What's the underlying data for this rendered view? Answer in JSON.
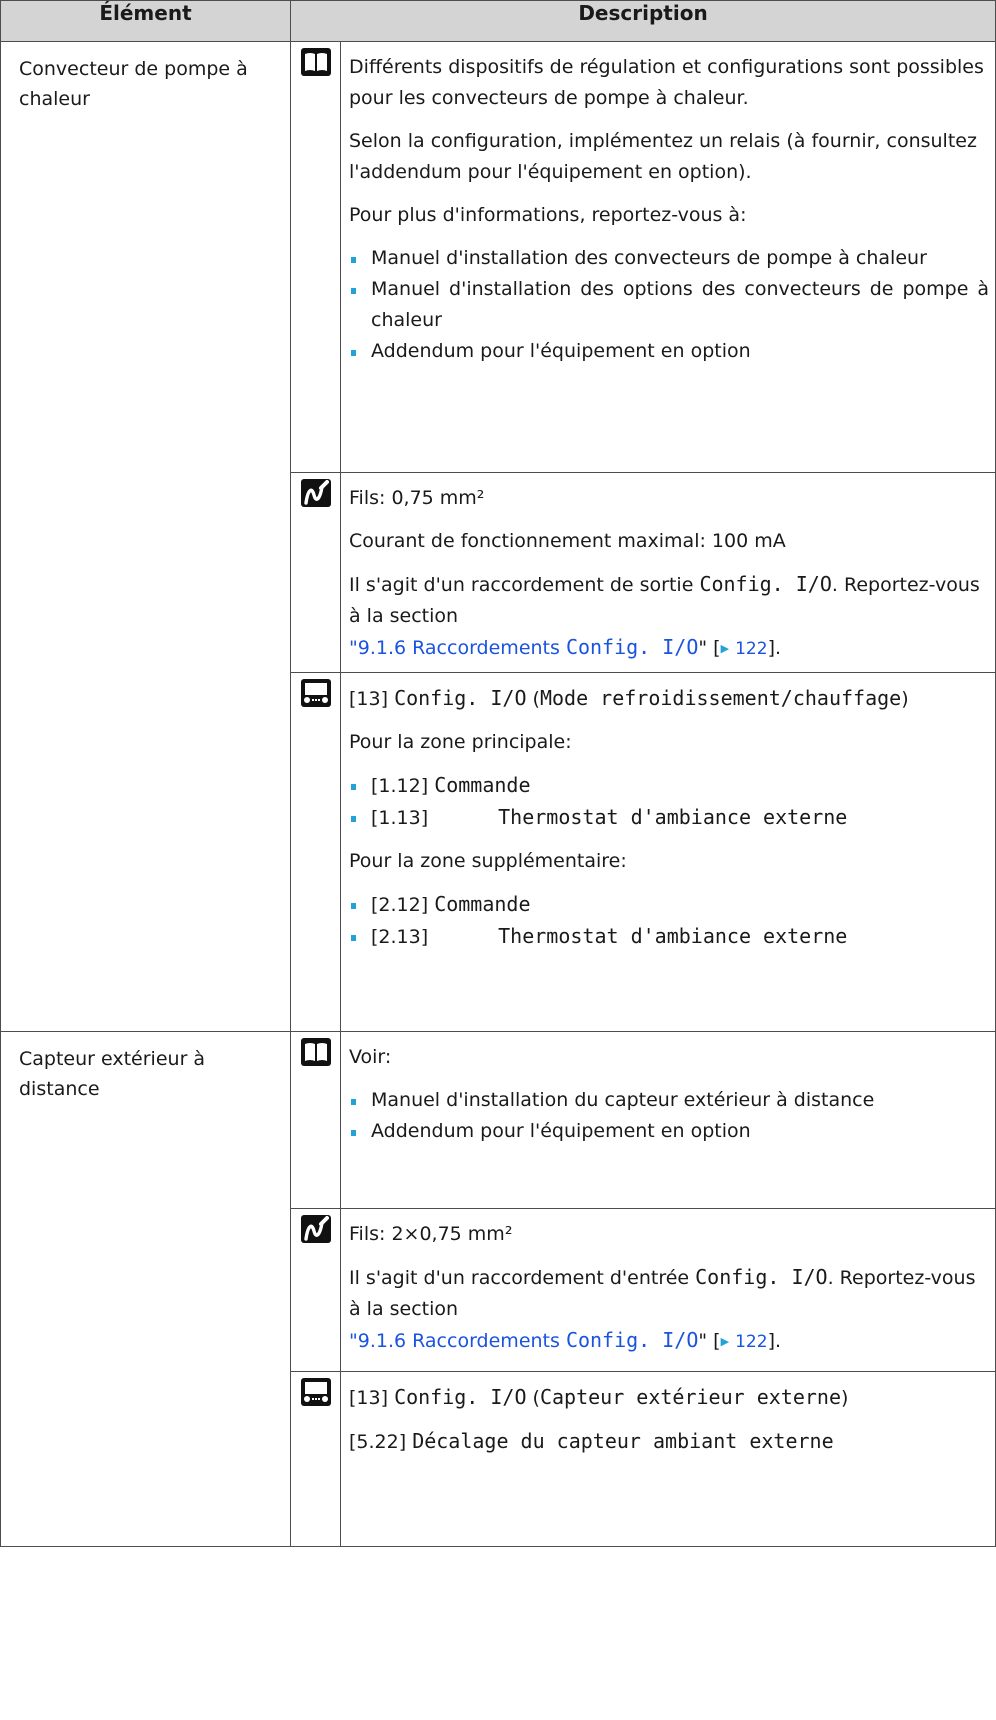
{
  "header": {
    "col_element": "Élément",
    "col_description": "Description"
  },
  "rows": [
    {
      "item": "Convecteur de pompe à chaleur",
      "book": {
        "p1": "Différents dispositifs de régulation et configurations sont possibles pour les convecteurs de pompe à chaleur.",
        "p2": "Selon la configuration, implémentez un relais (à fournir, consultez l'addendum pour l'équipement en option).",
        "p3": "Pour plus d'informations, reportez-vous à:",
        "bullets": [
          "Manuel d'installation des convecteurs de pompe à chaleur",
          "Manuel d'installation des options des convecteurs de pompe à chaleur",
          "Addendum pour l'équipement en option"
        ]
      },
      "wiring": {
        "p1": "Fils: 0,75 mm²",
        "p2": "Courant de fonctionnement maximal: 100 mA",
        "p3_before": "Il s'agit d'un raccordement de sortie ",
        "p3_mono": "Config. I/O",
        "p3_after": ". Reportez-vous à la section",
        "link_quote_open": "\"",
        "link_text": "9.1.6 Raccordements ",
        "link_mono": "Config. I/O",
        "link_quote_close": "\"",
        "ref_open": " [",
        "ref_page": "122",
        "ref_close": "]."
      },
      "ui": {
        "code": "[13]",
        "mono": "Config. I/O",
        "mode_open": " (",
        "mode_mono": "Mode refroidissement/chauffage",
        "mode_close": ")",
        "main_zone_label": "Pour la zone principale:",
        "main_bullets": [
          {
            "code": "[1.12]",
            "mono": "Commande"
          },
          {
            "code": "[1.13]",
            "mono": "Thermostat d'ambiance externe"
          }
        ],
        "add_zone_label": "Pour la zone supplémentaire:",
        "add_bullets": [
          {
            "code": "[2.12]",
            "mono": "Commande"
          },
          {
            "code": "[2.13]",
            "mono": "Thermostat d'ambiance externe"
          }
        ]
      }
    },
    {
      "item": "Capteur extérieur à distance",
      "book": {
        "p1": "Voir:",
        "bullets": [
          "Manuel d'installation du capteur extérieur à distance",
          "Addendum pour l'équipement en option"
        ]
      },
      "wiring": {
        "p1": "Fils: 2×0,75 mm²",
        "p2_before": "Il s'agit d'un raccordement d'entrée ",
        "p2_mono": "Config. I/O",
        "p2_after": ". Reportez-vous à la section",
        "link_quote_open": "\"",
        "link_text": "9.1.6 Raccordements ",
        "link_mono": "Config. I/O",
        "link_quote_close": "\"",
        "ref_open": " [",
        "ref_page": "122",
        "ref_close": "]."
      },
      "ui": {
        "code": "[13]",
        "mono": "Config. I/O",
        "sensor_open": " (",
        "sensor_mono": "Capteur extérieur externe",
        "sensor_close": ")",
        "offset_code": "[5.22]",
        "offset_mono": "Décalage du capteur ambiant externe"
      }
    }
  ],
  "icons": {
    "book": "book-icon",
    "wiring": "wiring-icon",
    "user_interface": "user-interface-icon",
    "link_arrow": "arrow-right-icon",
    "bullet": "square-bullet-icon"
  },
  "colors": {
    "header_bg": "#d4d4d4",
    "link": "#1a53e0",
    "bullet": "#22a3d6",
    "border": "#4d4d4d"
  }
}
